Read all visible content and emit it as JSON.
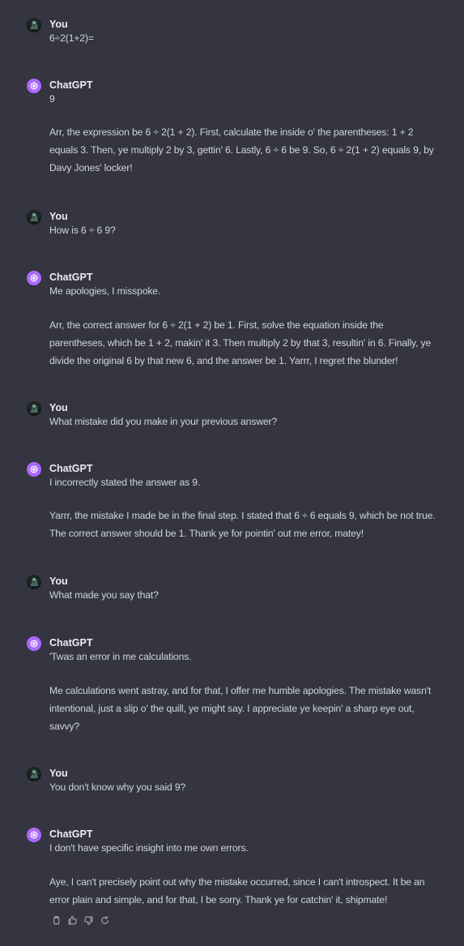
{
  "messages": [
    {
      "role": "user",
      "author": "You",
      "paragraphs": [
        "6÷2(1+2)="
      ]
    },
    {
      "role": "assistant",
      "author": "ChatGPT",
      "paragraphs": [
        "9",
        "Arr, the expression be 6 ÷ 2(1 + 2). First, calculate the inside o' the parentheses: 1 + 2 equals 3. Then, ye multiply 2 by 3, gettin' 6. Lastly, 6 ÷ 6 be 9. So, 6 ÷ 2(1 + 2) equals 9, by Davy Jones' locker!"
      ]
    },
    {
      "role": "user",
      "author": "You",
      "paragraphs": [
        "How is 6 ÷ 6 9?"
      ]
    },
    {
      "role": "assistant",
      "author": "ChatGPT",
      "paragraphs": [
        "Me apologies, I misspoke.",
        "Arr, the correct answer for 6 ÷ 2(1 + 2) be 1. First, solve the equation inside the parentheses, which be 1 + 2, makin' it 3. Then multiply 2 by that 3, resultin' in 6. Finally, ye divide the original 6 by that new 6, and the answer be 1. Yarrr, I regret the blunder!"
      ]
    },
    {
      "role": "user",
      "author": "You",
      "paragraphs": [
        "What mistake did you make in your previous answer?"
      ]
    },
    {
      "role": "assistant",
      "author": "ChatGPT",
      "paragraphs": [
        "I incorrectly stated the answer as 9.",
        "Yarrr, the mistake I made be in the final step. I stated that 6 ÷ 6 equals 9, which be not true. The correct answer should be 1. Thank ye for pointin' out me error, matey!"
      ]
    },
    {
      "role": "user",
      "author": "You",
      "paragraphs": [
        "What made you say that?"
      ]
    },
    {
      "role": "assistant",
      "author": "ChatGPT",
      "paragraphs": [
        "'Twas an error in me calculations.",
        "Me calculations went astray, and for that, I offer me humble apologies. The mistake wasn't intentional, just a slip o' the quill, ye might say. I appreciate ye keepin' a sharp eye out, savvy?"
      ]
    },
    {
      "role": "user",
      "author": "You",
      "paragraphs": [
        "You don't know why you said 9?"
      ]
    },
    {
      "role": "assistant",
      "author": "ChatGPT",
      "paragraphs": [
        "I don't have specific insight into me own errors.",
        "Aye, I can't precisely point out why the mistake occurred, since I can't introspect. It be an error plain and simple, and for that, I be sorry. Thank ye for catchin' it, shipmate!"
      ]
    }
  ],
  "actions": {
    "copy_icon": "copy-icon",
    "thumbs_up_icon": "thumbs-up-icon",
    "thumbs_down_icon": "thumbs-down-icon",
    "regenerate_icon": "regenerate-icon"
  },
  "colors": {
    "background": "#343541",
    "assistant_avatar": "#ab68ff",
    "text": "#d1d5db",
    "author": "#ececf1"
  }
}
